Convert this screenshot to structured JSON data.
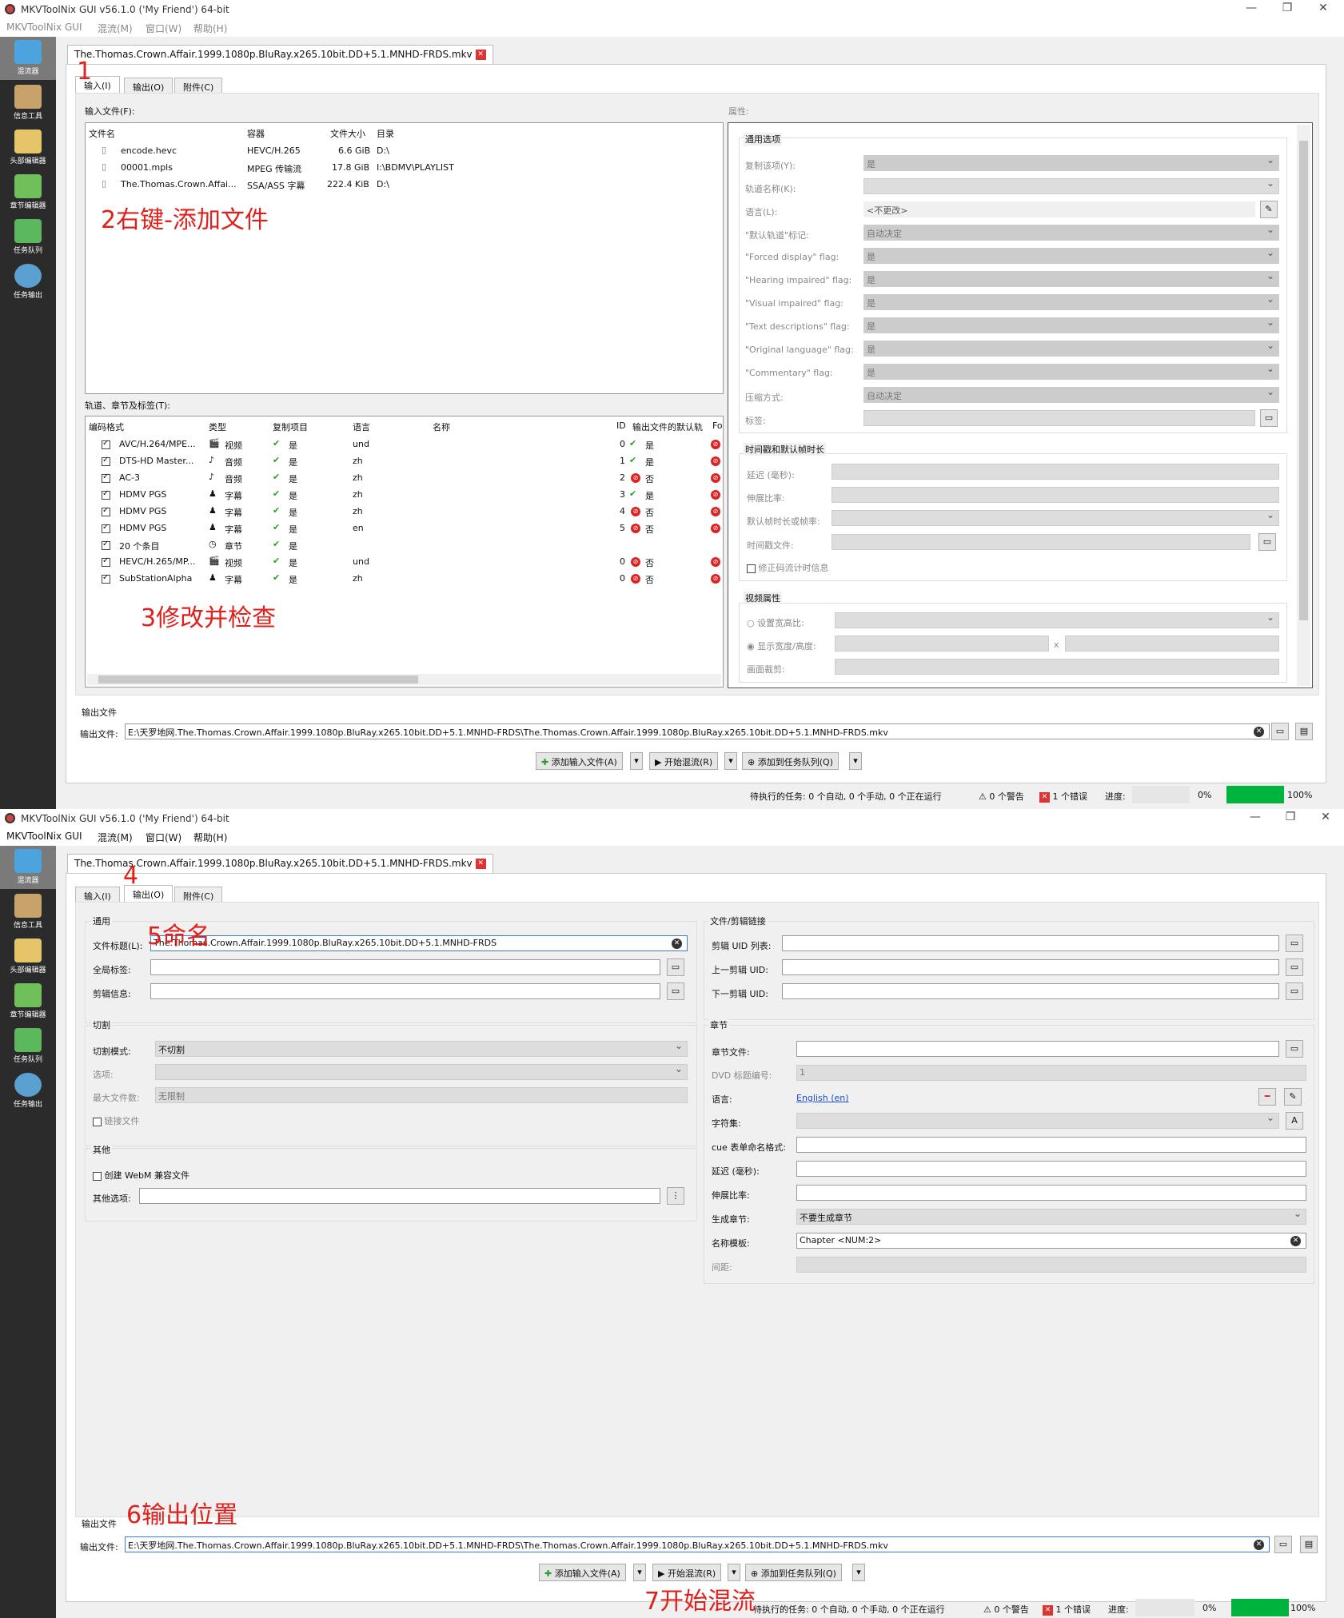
{
  "app": {
    "title": "MKVToolNix GUI v56.1.0 ('My Friend') 64-bit",
    "menu": [
      "MKVToolNix GUI",
      "混流(M)",
      "窗口(W)",
      "帮助(H)"
    ],
    "win_min": "—",
    "win_max": "❐",
    "win_close": "✕"
  },
  "sidebar": [
    "混流器",
    "信息工具",
    "头部编辑器",
    "章节编辑器",
    "任务队列",
    "任务输出"
  ],
  "file_tab": "The.Thomas.Crown.Affair.1999.1080p.BluRay.x265.10bit.DD+5.1.MNHD-FRDS.mkv",
  "subtabs": [
    "输入(I)",
    "输出(O)",
    "附件(C)"
  ],
  "input": {
    "input_files_label": "输入文件(F):",
    "file_headers": [
      "文件名",
      "容器",
      "文件大小",
      "目录"
    ],
    "files": [
      {
        "name": "encode.hevc",
        "container": "HEVC/H.265",
        "size": "6.6 GiB",
        "dir": "D:\\"
      },
      {
        "name": "00001.mpls",
        "container": "MPEG 传输流",
        "size": "17.8 GiB",
        "dir": "I:\\BDMV\\PLAYLIST"
      },
      {
        "name": "The.Thomas.Crown.Affai...",
        "container": "SSA/ASS 字幕",
        "size": "222.4 KiB",
        "dir": "D:\\"
      }
    ],
    "tracks_label": "轨道、章节及标签(T):",
    "track_headers": [
      "编码格式",
      "类型",
      "复制项目",
      "语言",
      "名称",
      "ID",
      "输出文件的默认轨",
      "Fo"
    ],
    "tracks": [
      {
        "codec": "AVC/H.264/MPE...",
        "type": "视频",
        "copy": "是",
        "lang": "und",
        "id": "0",
        "def_ok": true,
        "def": "是"
      },
      {
        "codec": "DTS-HD Master...",
        "type": "音频",
        "copy": "是",
        "lang": "zh",
        "id": "1",
        "def_ok": true,
        "def": "是"
      },
      {
        "codec": "AC-3",
        "type": "音频",
        "copy": "是",
        "lang": "zh",
        "id": "2",
        "def_ok": false,
        "def": "否"
      },
      {
        "codec": "HDMV PGS",
        "type": "字幕",
        "copy": "是",
        "lang": "zh",
        "id": "3",
        "def_ok": true,
        "def": "是"
      },
      {
        "codec": "HDMV PGS",
        "type": "字幕",
        "copy": "是",
        "lang": "zh",
        "id": "4",
        "def_ok": false,
        "def": "否"
      },
      {
        "codec": "HDMV PGS",
        "type": "字幕",
        "copy": "是",
        "lang": "en",
        "id": "5",
        "def_ok": false,
        "def": "否"
      },
      {
        "codec": "20 个条目",
        "type": "章节",
        "copy": "是",
        "lang": "",
        "id": "",
        "def_ok": null,
        "def": ""
      },
      {
        "codec": "HEVC/H.265/MP...",
        "type": "视频",
        "copy": "是",
        "lang": "und",
        "id": "0",
        "def_ok": false,
        "def": "否"
      },
      {
        "codec": "SubStationAlpha",
        "type": "字幕",
        "copy": "是",
        "lang": "zh",
        "id": "0",
        "def_ok": false,
        "def": "否"
      }
    ],
    "props_label": "属性:",
    "general_group": "通用选项",
    "props": [
      {
        "label": "复制该项(Y):",
        "value": "是"
      },
      {
        "label": "轨道名称(K):",
        "value": ""
      },
      {
        "label": "语言(L):",
        "value": "<不更改>"
      },
      {
        "label": "\"默认轨道\"标记:",
        "value": "自动决定"
      },
      {
        "label": "\"Forced display\" flag:",
        "value": "是"
      },
      {
        "label": "\"Hearing impaired\" flag:",
        "value": "是"
      },
      {
        "label": "\"Visual impaired\" flag:",
        "value": "是"
      },
      {
        "label": "\"Text descriptions\" flag:",
        "value": "是"
      },
      {
        "label": "\"Original language\" flag:",
        "value": "是"
      },
      {
        "label": "\"Commentary\" flag:",
        "value": "是"
      },
      {
        "label": "压缩方式:",
        "value": "自动决定"
      },
      {
        "label": "标签:",
        "value": ""
      }
    ],
    "timing_group": "时间戳和默认帧时长",
    "timing": [
      "延迟 (毫秒):",
      "伸展比率:",
      "默认帧时长或帧率:",
      "时间戳文件:"
    ],
    "fix_bitstream": "修正码流计时信息",
    "video_group": "视频属性",
    "aspect": "设置宽高比:",
    "display_wh": "显示宽度/高度:",
    "crop": "画面裁剪:"
  },
  "output_file": {
    "group": "输出文件",
    "label": "输出文件:",
    "path": "E:\\天罗地网.The.Thomas.Crown.Affair.1999.1080p.BluRay.x265.10bit.DD+5.1.MNHD-FRDS\\The.Thomas.Crown.Affair.1999.1080p.BluRay.x265.10bit.DD+5.1.MNHD-FRDS.mkv"
  },
  "buttons": {
    "add": "添加输入文件(A)",
    "start": "开始混流(R)",
    "queue": "添加到任务队列(Q)"
  },
  "status": {
    "pending": "待执行的任务: 0 个自动, 0 个手动, 0 个正在运行",
    "warnings": "0 个警告",
    "errors": "1 个错误",
    "progress_label": "进度:",
    "p1": "0%",
    "p2": "100%"
  },
  "output": {
    "general": "通用",
    "title_label": "文件标题(L):",
    "title_value": "The.Thomas.Crown.Affair.1999.1080p.BluRay.x265.10bit.DD+5.1.MNHD-FRDS",
    "global_tags": "全局标签:",
    "segment_info": "剪辑信息:",
    "split": "切割",
    "split_mode": "切割模式:",
    "split_mode_value": "不切割",
    "options": "选项:",
    "max_files": "最大文件数:",
    "max_files_value": "无限制",
    "link_files": "链接文件",
    "other": "其他",
    "webm": "创建 WebM 兼容文件",
    "other_opts": "其他选项:",
    "seg_group": "文件/剪辑链接",
    "seg_uids": "剪辑 UID 列表:",
    "prev_uid": "上一剪辑 UID:",
    "next_uid": "下一剪辑 UID:",
    "chapters": "章节",
    "chap_file": "章节文件:",
    "dvd_title": "DVD 标题编号:",
    "dvd_value": "1",
    "lang": "语言:",
    "lang_value": "English (en)",
    "charset": "字符集:",
    "cue": "cue 表单命名格式:",
    "delay": "延迟 (毫秒):",
    "stretch": "伸展比率:",
    "gen": "生成章节:",
    "gen_value": "不要生成章节",
    "name_tpl": "名称模板:",
    "name_tpl_value": "Chapter <NUM:2>",
    "interval": "间距:"
  },
  "annotations": [
    "1",
    "2右键-添加文件",
    "3修改并检查",
    "4",
    "5命名",
    "6输出位置",
    "7开始混流"
  ]
}
